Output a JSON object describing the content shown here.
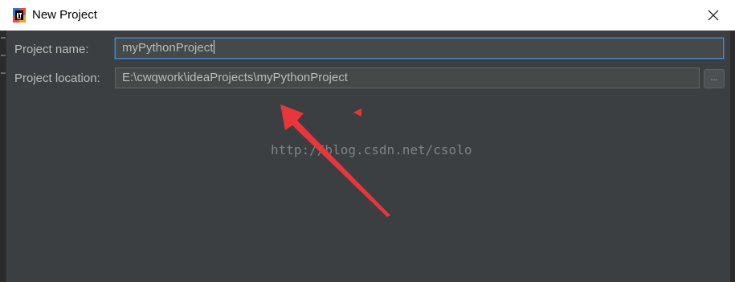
{
  "window": {
    "title": "New Project",
    "app_icon": "intellij-idea-icon",
    "close_icon": "close-icon"
  },
  "form": {
    "project_name_label": "Project name:",
    "project_name_value": "myPythonProject",
    "project_location_label": "Project location:",
    "project_location_value": "E:\\cwqwork\\ideaProjects\\myPythonProject",
    "browse_label": "..."
  },
  "overlay": {
    "watermark": "http://blog.csdn.net/csolo",
    "arrow_color": "#e8363a",
    "arrow_icon": "annotation-arrow-icon"
  },
  "colors": {
    "background": "#3c3f41",
    "titlebar": "#ffffff",
    "field_bg": "#45494a",
    "focus_border": "#4a88c7",
    "label_text": "#bbbbbb"
  }
}
